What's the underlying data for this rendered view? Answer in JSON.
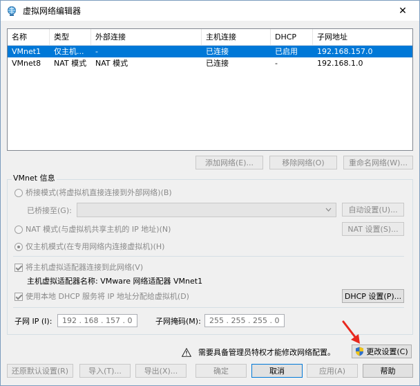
{
  "window": {
    "title": "虚拟网络编辑器",
    "close_glyph": "✕"
  },
  "table": {
    "headers": [
      "名称",
      "类型",
      "外部连接",
      "主机连接",
      "DHCP",
      "子网地址"
    ],
    "rows": [
      {
        "name": "VMnet1",
        "type": "仅主机...",
        "external": "-",
        "host": "已连接",
        "dhcp": "已启用",
        "subnet": "192.168.157.0",
        "selected": true
      },
      {
        "name": "VMnet8",
        "type": "NAT 模式",
        "external": "NAT 模式",
        "host": "已连接",
        "dhcp": "-",
        "subnet": "192.168.1.0",
        "selected": false
      }
    ]
  },
  "table_buttons": {
    "add": "添加网络(E)...",
    "remove": "移除网络(O)",
    "rename": "重命名网络(W)..."
  },
  "vmnet_info": {
    "title": "VMnet 信息",
    "bridge_option": "桥接模式(将虚拟机直接连接到外部网络)(B)",
    "bridged_to_label": "已桥接至(G):",
    "bridged_to_value": "",
    "auto_settings": "自动设置(U)...",
    "nat_option": "NAT 模式(与虚拟机共享主机的 IP 地址)(N)",
    "nat_settings": "NAT 设置(S)...",
    "hostonly_option": "仅主机模式(在专用网络内连接虚拟机)(H)",
    "connect_adapter": "将主机虚拟适配器连接到此网络(V)",
    "adapter_name_label": "主机虚拟适配器名称: VMware 网络适配器 VMnet1",
    "use_dhcp": "使用本地 DHCP 服务将 IP 地址分配给虚拟机(D)",
    "dhcp_settings": "DHCP 设置(P)...",
    "subnet_ip_label": "子网 IP (I):",
    "subnet_ip_value": "192 . 168 . 157 . 0",
    "subnet_mask_label": "子网掩码(M):",
    "subnet_mask_value": "255 . 255 . 255 . 0"
  },
  "warning": {
    "text": "需要具备管理员特权才能修改网络配置。",
    "change_settings": "更改设置(C)"
  },
  "footer_buttons": {
    "restore_defaults": "还原默认设置(R)",
    "import": "导入(T)...",
    "export": "导出(X)...",
    "ok": "确定",
    "cancel": "取消",
    "apply": "应用(A)",
    "help": "帮助"
  },
  "colors": {
    "selection": "#0078d7",
    "annotation_arrow": "#e8281e",
    "disabled_text": "#8a8a8a",
    "warning_fill": "#f0c419"
  }
}
